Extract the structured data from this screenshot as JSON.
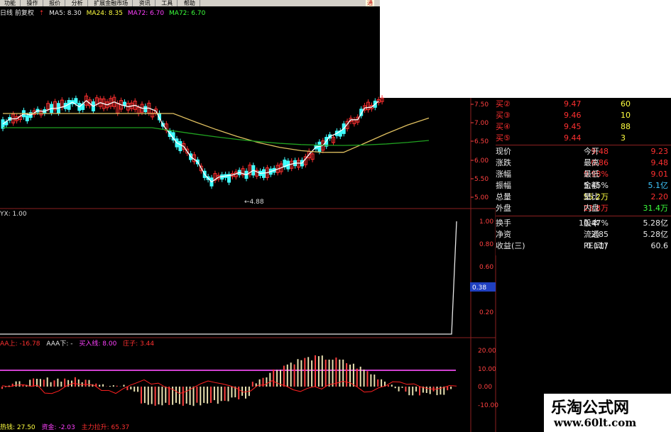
{
  "menu": [
    "功能",
    "操作",
    "报价",
    "分析",
    "扩展金融市场",
    "资讯",
    "工具",
    "帮助"
  ],
  "menu_corner": "通",
  "main_info": {
    "period": "日线 前复权",
    "ma5": "MA5: 8.30",
    "ma24": "MA24: 8.35",
    "ma72a": "MA72: 6.70",
    "ma72b": "MA72: 6.70"
  },
  "price_axis": [
    "7.50",
    "7.00",
    "6.50",
    "6.00",
    "5.50",
    "5.00"
  ],
  "low_label": "4.88",
  "ind1": {
    "label": "YX: 1.00",
    "axis": [
      "1.00",
      "0.80",
      "0.60",
      "0.40",
      "0.20"
    ],
    "cursor_value": "0.38"
  },
  "ind2": {
    "aa_up": "AA上: -16.78",
    "aa_down": "AAA下: -",
    "buy": "买入线: 8.00",
    "chengzi": "庄子: 3.44",
    "axis": [
      "20.00",
      "10.00",
      "0.00",
      "-10.00"
    ]
  },
  "bottom": {
    "a": "热钱: 27.50",
    "b": "资金: -2.03",
    "c": "主力拉升: 65.37"
  },
  "quote": {
    "bids": [
      {
        "label": "买②",
        "price": "9.47",
        "vol": "60"
      },
      {
        "label": "买③",
        "price": "9.46",
        "vol": "10"
      },
      {
        "label": "买④",
        "price": "9.45",
        "vol": "88"
      },
      {
        "label": "买⑤",
        "price": "9.44",
        "vol": "3"
      }
    ],
    "rows1": [
      {
        "l": "现价",
        "v": "9.48",
        "l2": "今开",
        "v2": "9.23"
      },
      {
        "l": "涨跌",
        "v": "0.86",
        "l2": "最高",
        "v2": "9.48"
      },
      {
        "l": "涨幅",
        "v": "9.98%",
        "l2": "最低",
        "v2": "9.01"
      },
      {
        "l": "振幅",
        "v": "5.45%",
        "l2": "金额",
        "v2": "5.1亿"
      },
      {
        "l": "总量",
        "v": "55.2万",
        "l2": "量比",
        "v2": "2.20"
      },
      {
        "l": "外盘",
        "v": "23.8万",
        "l2": "内盘",
        "v2": "31.4万"
      }
    ],
    "rows2": [
      {
        "l": "换手",
        "v": "10.47%",
        "l2": "股本",
        "v2": "5.28亿"
      },
      {
        "l": "净资",
        "v": "2.85",
        "l2": "流通",
        "v2": "5.28亿"
      },
      {
        "l": "收益(三)",
        "v": "0.117",
        "l2": "PE(动)",
        "v2": "60.6"
      }
    ]
  },
  "watermark": {
    "title": "乐淘公式网",
    "url": "www.60lt.com"
  },
  "colors": {
    "up": "#ff3030",
    "down": "#40ffff",
    "ma_short": "#ffffff",
    "ma_mid": "#e0c060",
    "ma_long": "#20a020",
    "divider": "#8c2020"
  }
}
